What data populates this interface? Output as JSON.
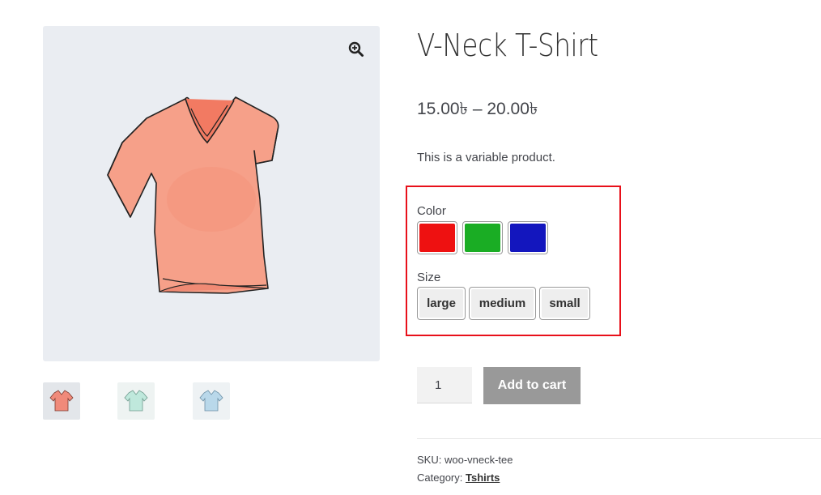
{
  "product": {
    "title": "V-Neck T-Shirt",
    "price_range": "15.00৳ – 20.00৳",
    "description": "This is a variable product.",
    "image_icon": "tshirt-image",
    "thumbnails": [
      {
        "name": "red-tshirt-thumbnail",
        "color": "#f08a7a"
      },
      {
        "name": "green-tshirt-thumbnail",
        "color": "#bfe8dc"
      },
      {
        "name": "blue-tshirt-thumbnail",
        "color": "#b9d8ea"
      }
    ]
  },
  "zoom": {
    "icon": "magnifier-plus-icon"
  },
  "variations": {
    "color_label": "Color",
    "colors": [
      {
        "name": "red",
        "hex": "#ee1111"
      },
      {
        "name": "green",
        "hex": "#1aad24"
      },
      {
        "name": "blue",
        "hex": "#1316be"
      }
    ],
    "size_label": "Size",
    "sizes": [
      "large",
      "medium",
      "small"
    ],
    "highlight_color": "#e8101a"
  },
  "cart": {
    "quantity": "1",
    "add_to_cart_label": "Add to cart"
  },
  "meta": {
    "sku_label": "SKU:",
    "sku_value": "woo-vneck-tee",
    "category_label": "Category:",
    "category_value": "Tshirts"
  }
}
